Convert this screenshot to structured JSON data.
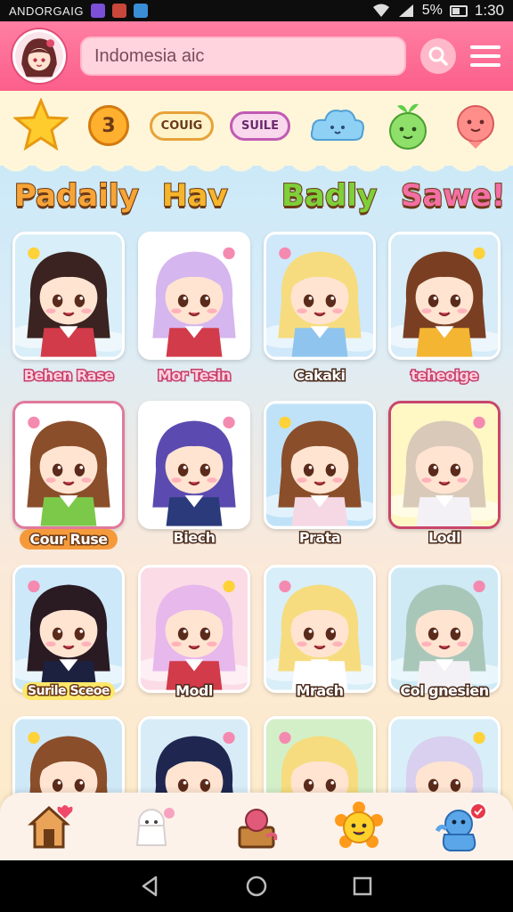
{
  "status_bar": {
    "carrier": "ANDORGAIG",
    "battery": "5%",
    "time": "1:30",
    "icons": [
      "heart-app-icon",
      "book-app-icon",
      "download-app-icon",
      "wifi-icon",
      "signal-icon",
      "battery-icon"
    ]
  },
  "header": {
    "search_value": "Indomesia aic",
    "search_icon": "search-icon",
    "menu_icon": "hamburger-menu-icon"
  },
  "categories": [
    {
      "type": "icon",
      "name": "star-icon"
    },
    {
      "type": "badge",
      "text": "3"
    },
    {
      "type": "pill",
      "text": "COUIG"
    },
    {
      "type": "pill",
      "text": "SUILE"
    },
    {
      "type": "icon",
      "name": "cloud-face-icon"
    },
    {
      "type": "icon",
      "name": "sprout-face-icon"
    },
    {
      "type": "icon",
      "name": "pink-face-icon"
    }
  ],
  "section_headings": [
    {
      "text": "Padaily",
      "color": "#f7a437"
    },
    {
      "text": "Hav",
      "color": "#f5b52c"
    },
    {
      "text": "Badly",
      "color": "#7fcf3a"
    },
    {
      "text": "Sawe!",
      "color": "#f46fa3"
    }
  ],
  "characters": [
    {
      "name": "Behen Rase",
      "hair": "#3a2320",
      "outfit": "#d23b49",
      "bg": "#d8eef8"
    },
    {
      "name": "Mor Tesin",
      "hair": "#d6b6ee",
      "outfit": "#d23b49",
      "bg": "#ffffff"
    },
    {
      "name": "Cakaki",
      "hair": "#f6dc7e",
      "outfit": "#8fc4ee",
      "bg": "#cfe8fa"
    },
    {
      "name": "teheoige",
      "hair": "#7a3f22",
      "outfit": "#f3b532",
      "bg": "#d6ecf8"
    },
    {
      "name": "Cour Ruse",
      "hair": "#8a4e2a",
      "outfit": "#7cc94a",
      "bg": "#ffffff"
    },
    {
      "name": "Biech",
      "hair": "#5b4bb0",
      "outfit": "#2a3a7a",
      "bg": "#ffffff"
    },
    {
      "name": "Prata",
      "hair": "#8a4e2a",
      "outfit": "#f6d8e4",
      "bg": "#bfe2f8"
    },
    {
      "name": "Lodl",
      "hair": "#d9c9b8",
      "outfit": "#f4f1f6",
      "bg": "#fff7c4"
    },
    {
      "name": "Surile Sceoe",
      "hair": "#2a1a22",
      "outfit": "#1d2140",
      "bg": "#cde8f8"
    },
    {
      "name": "Modl",
      "hair": "#e7b8ec",
      "outfit": "#d23b49",
      "bg": "#fbdbe6"
    },
    {
      "name": "Mrach",
      "hair": "#f6dc7e",
      "outfit": "#ffffff",
      "bg": "#d8eef8"
    },
    {
      "name": "Col gnesien",
      "hair": "#a9c7b9",
      "outfit": "#f4f1f6",
      "bg": "#cfeaf5"
    },
    {
      "name": "",
      "hair": "#8a4e2a",
      "outfit": "#d23b49",
      "bg": "#cfe8f8"
    },
    {
      "name": "",
      "hair": "#1f2750",
      "outfit": "#2a3a7a",
      "bg": "#d8ecf8"
    },
    {
      "name": "",
      "hair": "#f6dc7e",
      "outfit": "#ffffff",
      "bg": "#d3efc8"
    },
    {
      "name": "",
      "hair": "#d8d0ee",
      "outfit": "#f6e0ea",
      "bg": "#d8eef8"
    }
  ],
  "tab_bar": [
    {
      "name": "home-house-icon"
    },
    {
      "name": "ghost-friends-icon"
    },
    {
      "name": "shop-chest-icon"
    },
    {
      "name": "sun-face-icon"
    },
    {
      "name": "blue-mascot-notification-icon"
    }
  ],
  "nav_bar": [
    "back-icon",
    "home-icon",
    "recents-icon"
  ]
}
